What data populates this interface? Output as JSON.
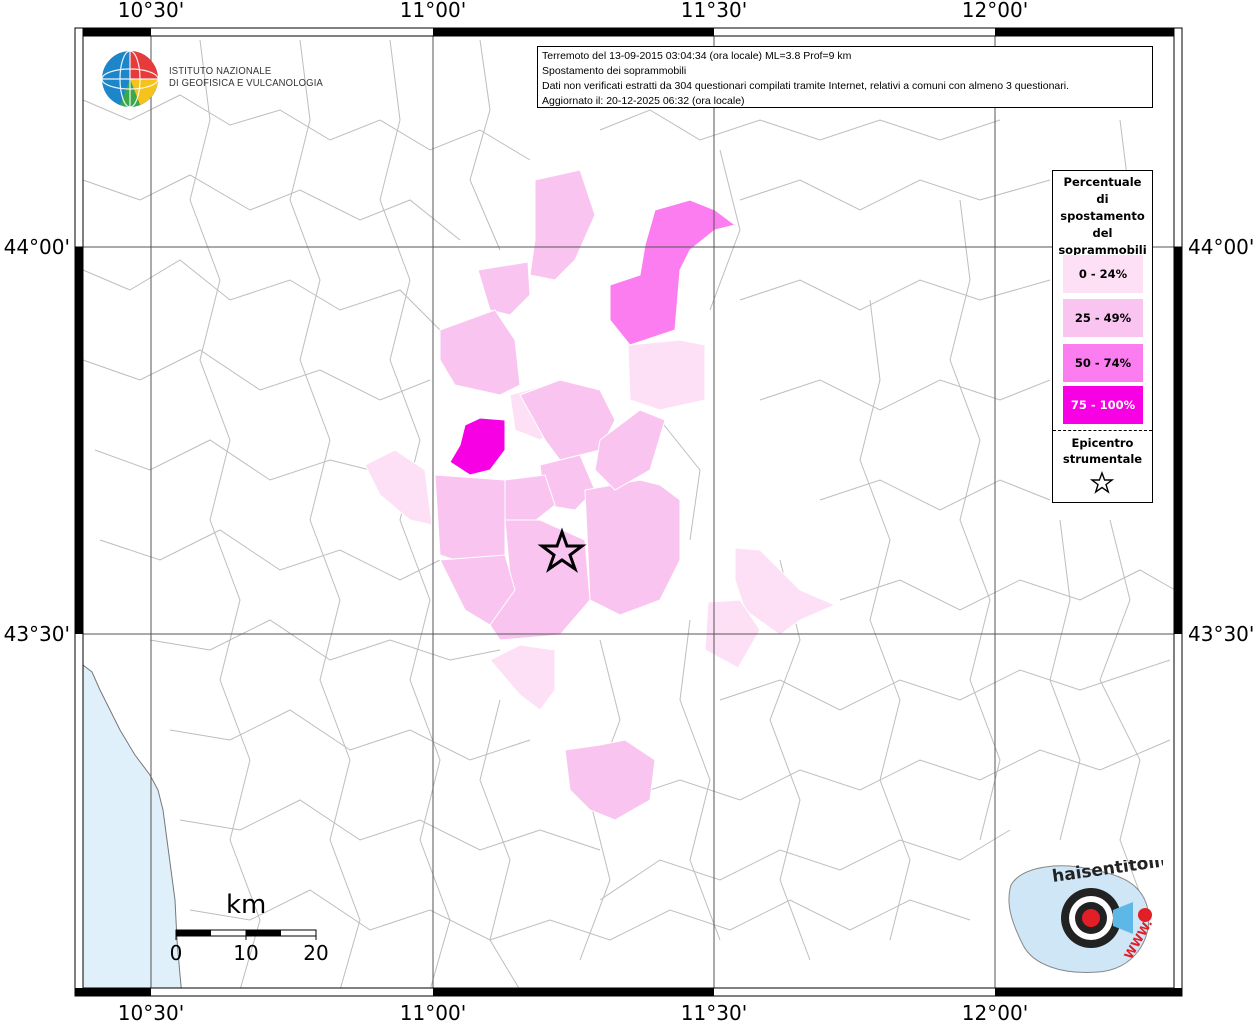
{
  "map": {
    "axis": {
      "lon_labels": [
        "10°30'",
        "11°00'",
        "11°30'",
        "12°00'"
      ],
      "lat_labels": [
        "44°00'",
        "43°30'"
      ]
    },
    "epicenter": {
      "lon": 11.23,
      "lat": 43.59
    }
  },
  "header": {
    "line1": "Terremoto del 13-09-2015 03:04:34 (ora locale) ML=3.8 Prof=9 km",
    "line2": "Spostamento dei soprammobili",
    "line3": "Dati non verificati estratti da 304 questionari compilati tramite Internet, relativi a comuni con almeno 3 questionari.",
    "line4": "Aggiornato il: 20-12-2025 06:32 (ora locale)"
  },
  "org": {
    "line1": "ISTITUTO NAZIONALE",
    "line2": "DI GEOFISICA E VULCANOLOGIA"
  },
  "legend": {
    "title_lines": [
      "Percentuale",
      "di",
      "spostamento",
      "del",
      "soprammobili"
    ],
    "classes": [
      {
        "label": "0 - 24%",
        "color": "#fde0f5"
      },
      {
        "label": "25 - 49%",
        "color": "#f9c4f0"
      },
      {
        "label": "50 - 74%",
        "color": "#fb7df0"
      },
      {
        "label": "75 - 100%",
        "color": "#f700e3"
      }
    ],
    "epicenter_lines": [
      "Epicentro",
      "strumentale"
    ]
  },
  "scale": {
    "unit": "km",
    "ticks": [
      "0",
      "10",
      "20"
    ]
  },
  "watermark": {
    "text": "haisentitoilterremoto.it",
    "url": "WWW."
  },
  "colors": {
    "sea": "#dff0fb",
    "frame": "#000000",
    "grid": "#555555",
    "borders": "#bdbdbd"
  }
}
